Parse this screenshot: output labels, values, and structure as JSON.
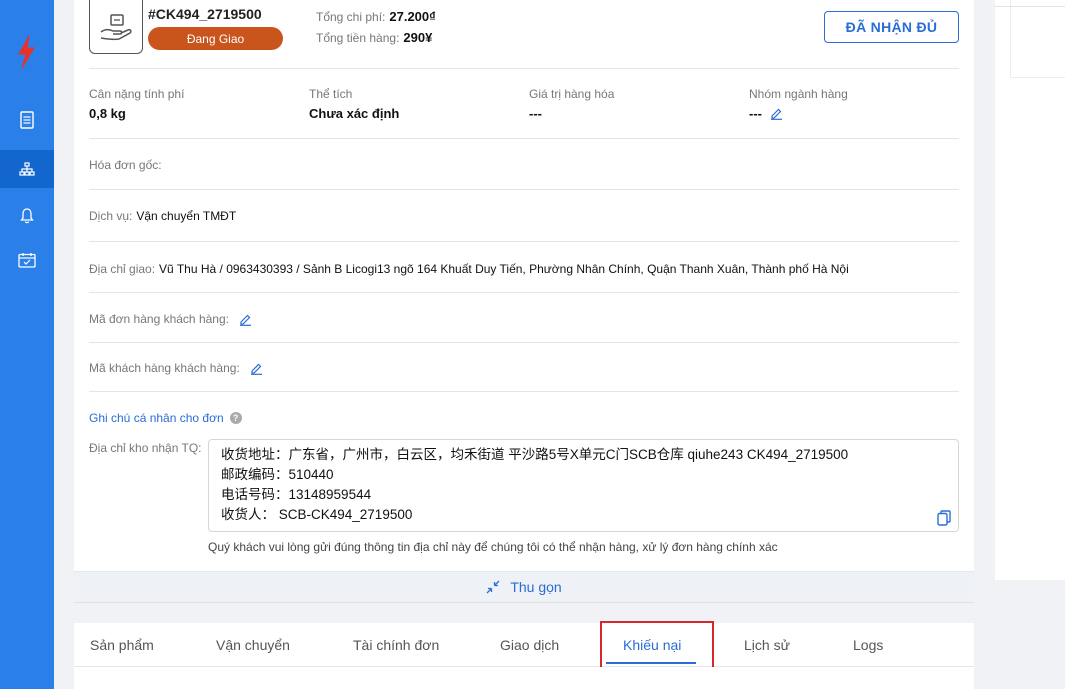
{
  "order": {
    "code": "#CK494_2719500",
    "status": "Đang Giao",
    "total_cost_label": "Tổng chi phí:",
    "total_cost_value": "27.200₫",
    "total_goods_label": "Tổng tiền hàng:",
    "total_goods_value": "290¥",
    "received_button": "ĐÃ NHẬN ĐỦ"
  },
  "info": {
    "weight_label": "Cân nặng tính phí",
    "weight_value": "0,8 kg",
    "volume_label": "Thể tích",
    "volume_value": "Chưa xác định",
    "goods_value_label": "Giá trị hàng hóa",
    "goods_value_value": "---",
    "category_label": "Nhóm ngành hàng",
    "category_value": "---"
  },
  "rows": {
    "invoice_label": "Hóa đơn gốc:",
    "service_label": "Dịch vụ:",
    "service_value": "Vận chuyển TMĐT",
    "address_label": "Địa chỉ giao:",
    "address_value": "Vũ Thu Hà / 0963430393 / Sảnh B Licogi13 ngõ 164 Khuất Duy Tiến, Phường Nhân Chính, Quận Thanh Xuân, Thành phố Hà Nội",
    "customer_order_label": "Mã đơn hàng khách hàng:",
    "customer_code_label": "Mã khách hàng khách hàng:",
    "personal_note_link": "Ghi chú cá nhân cho đơn"
  },
  "warehouse": {
    "label": "Địa chỉ kho nhận TQ:",
    "line1": "收货地址：广东省，广州市，白云区，均禾街道 平沙路5号X单元C门SCB仓库 qiuhe243 CK494_2719500",
    "line2": "邮政编码：510440",
    "line3": "电话号码：13148959544",
    "line4": "收货人： SCB-CK494_2719500",
    "hint": "Quý khách vui lòng gửi đúng thông tin địa chỉ này để chúng tôi có thể nhận hàng, xử lý đơn hàng chính xác"
  },
  "collapse_label": "Thu gọn",
  "tabs": [
    {
      "label": "Sản phẩm"
    },
    {
      "label": "Vận chuyển"
    },
    {
      "label": "Tài chính đơn"
    },
    {
      "label": "Giao dịch"
    },
    {
      "label": "Khiếu nại"
    },
    {
      "label": "Lịch sử"
    },
    {
      "label": "Logs"
    }
  ],
  "colors": {
    "sidebar": "#2a7fe8",
    "accent": "#2a6dd4",
    "status": "#c9541c",
    "highlight": "#d4282e"
  }
}
